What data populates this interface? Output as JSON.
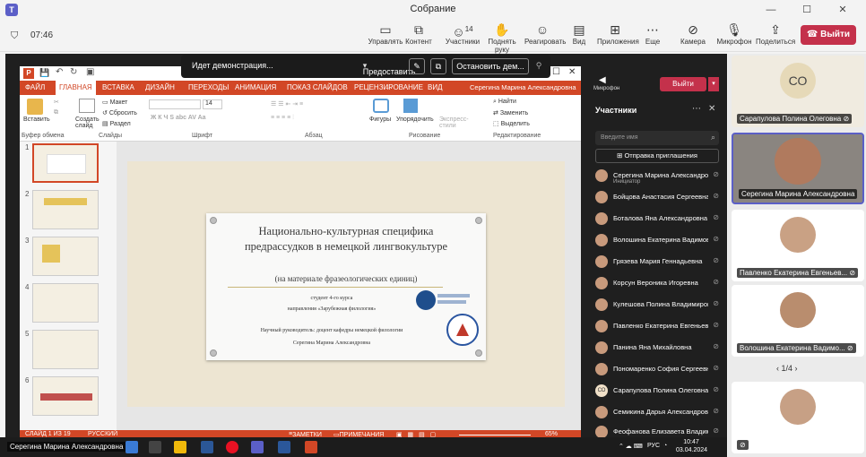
{
  "window": {
    "title": "Собрание",
    "icon": "teams-icon"
  },
  "meeting_toolbar": {
    "time": "07:46",
    "tools": [
      {
        "label": "Управлять",
        "icon": "share-manage-icon"
      },
      {
        "label": "Контент",
        "icon": "content-icon"
      },
      {
        "label": "Участники",
        "icon": "people-icon",
        "count": "14"
      },
      {
        "label": "Поднять руку",
        "icon": "raise-hand-icon"
      },
      {
        "label": "Реагировать",
        "icon": "emoji-icon"
      },
      {
        "label": "Вид",
        "icon": "view-icon"
      },
      {
        "label": "Приложения",
        "icon": "apps-icon"
      },
      {
        "label": "Еще",
        "icon": "more-icon"
      },
      {
        "label": "Камера",
        "icon": "camera-off-icon"
      },
      {
        "label": "Микрофон",
        "icon": "mic-off-icon"
      },
      {
        "label": "Поделиться",
        "icon": "share-icon"
      }
    ],
    "leave_label": "Выйти",
    "leave_color": "#c4314b"
  },
  "share_bar": {
    "status": "Идет демонстрация...",
    "give_control": "Предоставить ...",
    "stop": "Остановить дем..."
  },
  "powerpoint": {
    "tabs": [
      "ФАЙЛ",
      "ГЛАВНАЯ",
      "ВСТАВКА",
      "ДИЗАЙН",
      "ПЕРЕХОДЫ",
      "АНИМАЦИЯ",
      "ПОКАЗ СЛАЙДОВ",
      "РЕЦЕНЗИРОВАНИЕ",
      "ВИД"
    ],
    "active_tab": "ГЛАВНАЯ",
    "user": "Серегина Марина Александровна",
    "ribbon": {
      "insert": "Вставить",
      "create_slide": "Создать слайд",
      "layout": "Макет",
      "reset": "Сбросить",
      "section": "Раздел",
      "font_size": "14",
      "shapes": "Фигуры",
      "arrange": "Упорядочить",
      "express_styles": "Экспресс-стили",
      "find": "Найти",
      "replace": "Заменить",
      "select": "Выделить",
      "groups": [
        "Буфер обмена",
        "Слайды",
        "Шрифт",
        "Абзац",
        "Рисование",
        "Редактирование"
      ]
    },
    "thumbnails": [
      "1",
      "2",
      "3",
      "4",
      "5",
      "6"
    ],
    "slide": {
      "title": "Национально-культурная специфика предрассудков в немецкой лингвокультуре",
      "subtitle": "(на материале фразеологических единиц)",
      "author_line1": "студент 4-го курса",
      "author_line2": "направления «Зарубежная филология»",
      "supervisor": "Научный руководитель: доцент кафедры немецкой филологии",
      "supervisor_name": "Серегина Марина Александровна"
    },
    "status": {
      "slide_counter": "СЛАЙД 1 ИЗ 19",
      "language": "РУССКИЙ",
      "notes": "ЗАМЕТКИ",
      "comments": "ПРИМЕЧАНИЯ",
      "zoom": "65%"
    },
    "accent": "#d24726"
  },
  "participants_panel": {
    "title": "Участники",
    "header_mic": "Микрофон",
    "header_leave": "Выйти",
    "search_placeholder": "Введите имя",
    "invite": "Отправка приглашения",
    "people": [
      {
        "name": "Серегина Марина Александровна",
        "role": "Инициатор"
      },
      {
        "name": "Бойцова Анастасия Сергеевна"
      },
      {
        "name": "Боталова Яна Александровна"
      },
      {
        "name": "Волошина Екатерина Вадимовна"
      },
      {
        "name": "Грязева Мария Геннадьевна"
      },
      {
        "name": "Корсун Вероника Игоревна"
      },
      {
        "name": "Кулешова Полина Владимировна"
      },
      {
        "name": "Павленко Екатерина Евгеньевна"
      },
      {
        "name": "Панина Яна Михайловна"
      },
      {
        "name": "Пономаренко София Сергеевна"
      },
      {
        "name": "Сарапулова Полина Олеговна",
        "initials": "СО"
      },
      {
        "name": "Семикина Дарья Александровна"
      },
      {
        "name": "Феофанова Елизавета Владимировна"
      }
    ]
  },
  "gallery": {
    "tiles": [
      {
        "name": "Сарапулова Полина Олеговна",
        "initials": "СО"
      },
      {
        "name": "Серегина Марина Александровна"
      },
      {
        "name": "Павленко Екатерина Евгеньев..."
      },
      {
        "name": "Волошина Екатерина Вадимо..."
      },
      {
        "name": ""
      }
    ],
    "pager": "1/4"
  },
  "taskbar": {
    "presenter": "Серегина Марина Александровна",
    "lang": "РУС",
    "time": "10:47",
    "date": "03.04.2024"
  }
}
